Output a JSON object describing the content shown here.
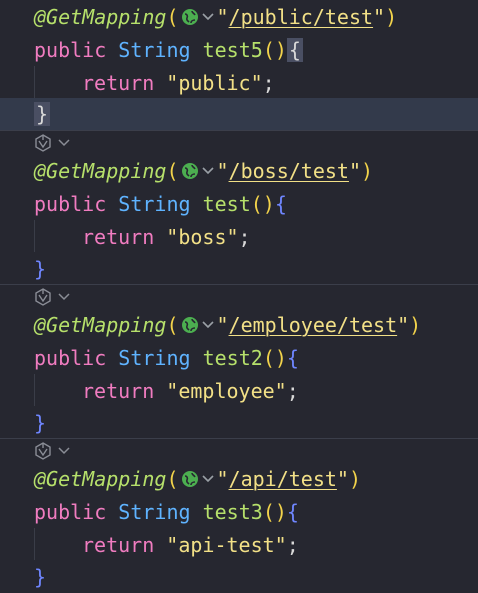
{
  "colors": {
    "background": "#262730",
    "keyword": "#f07cc0",
    "type": "#5fb3ff",
    "method": "#b6e06b",
    "string": "#f2e087",
    "brace": "#6f86ff",
    "highlight_line": "#333a4b"
  },
  "icons": {
    "gutter": "ai-assistant-icon",
    "chevron": "chevron-down-icon",
    "endpoint": "globe-icon"
  },
  "blocks": [
    {
      "annotation": "@GetMapping",
      "path": "/public/test",
      "kw_public": "public",
      "type": "String",
      "method": "test5",
      "return_kw": "return",
      "return_value": "\"public\"",
      "semicolon": ";"
    },
    {
      "annotation": "@GetMapping",
      "path": "/boss/test",
      "kw_public": "public",
      "type": "String",
      "method": "test",
      "return_kw": "return",
      "return_value": "\"boss\"",
      "semicolon": ";"
    },
    {
      "annotation": "@GetMapping",
      "path": "/employee/test",
      "kw_public": "public",
      "type": "String",
      "method": "test2",
      "return_kw": "return",
      "return_value": "\"employee\"",
      "semicolon": ";"
    },
    {
      "annotation": "@GetMapping",
      "path": "/api/test",
      "kw_public": "public",
      "type": "String",
      "method": "test3",
      "return_kw": "return",
      "return_value": "\"api-test\"",
      "semicolon": ";"
    }
  ],
  "punct": {
    "open_paren": "(",
    "close_paren": ")",
    "quote": "\"",
    "open_brace": "{",
    "close_brace": "}",
    "parens": "()"
  }
}
